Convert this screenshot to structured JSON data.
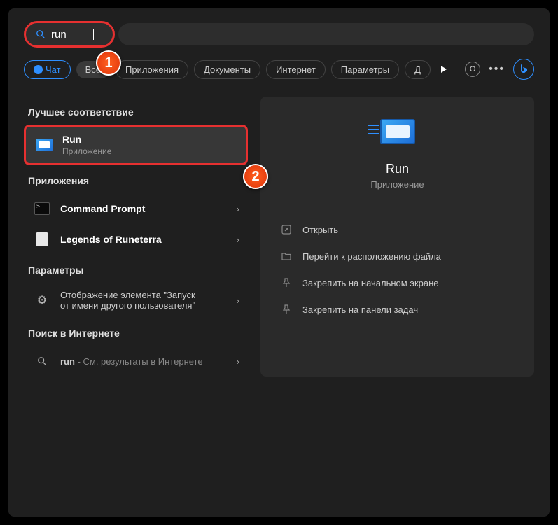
{
  "search": {
    "value": "run"
  },
  "tabs": {
    "chat": "Чат",
    "all": "Все",
    "apps": "Приложения",
    "docs": "Документы",
    "web": "Интернет",
    "settings": "Параметры",
    "more_prefix": "Д"
  },
  "sections": {
    "best_match": "Лучшее соответствие",
    "apps": "Приложения",
    "settings": "Параметры",
    "web": "Поиск в Интернете"
  },
  "results": {
    "run": {
      "title": "Run",
      "sub": "Приложение"
    },
    "cmd": {
      "title_pre": "Command P",
      "title_post": "rompt"
    },
    "lor": {
      "title_pre": "Legends of ",
      "title_bold": "Run",
      "title_post": "eterra"
    },
    "setting": {
      "line1": "Отображение элемента \"Запуск",
      "line2": "от имени другого пользователя\""
    },
    "web": {
      "query": "run",
      "suffix": " - См. результаты в Интернете"
    }
  },
  "detail": {
    "title": "Run",
    "sub": "Приложение",
    "actions": {
      "open": "Открыть",
      "location": "Перейти к расположению файла",
      "pin_start": "Закрепить на начальном экране",
      "pin_taskbar": "Закрепить на панели задач"
    }
  },
  "annotations": {
    "one": "1",
    "two": "2"
  }
}
